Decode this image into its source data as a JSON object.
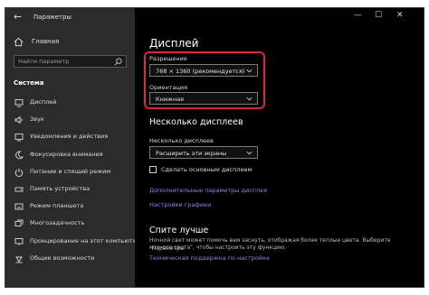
{
  "window": {
    "title": "Параметры",
    "controls": {
      "minimize": "—",
      "maximize": "☐",
      "close": "✕"
    }
  },
  "sidebar": {
    "home_label": "Главная",
    "search_placeholder": "Найти параметр",
    "section": "Система",
    "items": [
      {
        "label": "Дисплей",
        "icon": "monitor-icon"
      },
      {
        "label": "Звук",
        "icon": "speaker-icon"
      },
      {
        "label": "Уведомления и действия",
        "icon": "notification-icon"
      },
      {
        "label": "Фокусировка внимания",
        "icon": "moon-icon"
      },
      {
        "label": "Питание и спящий режим",
        "icon": "power-icon"
      },
      {
        "label": "Память устройства",
        "icon": "storage-icon"
      },
      {
        "label": "Режим планшета",
        "icon": "tablet-icon"
      },
      {
        "label": "Многозадачность",
        "icon": "multitask-icon"
      },
      {
        "label": "Проецирование на этот компьютер",
        "icon": "project-icon"
      },
      {
        "label": "Общие возможности",
        "icon": "share-icon"
      }
    ]
  },
  "main": {
    "title": "Дисплей",
    "resolution": {
      "label": "Разрешение",
      "value": "768 × 1360 (рекомендуется)"
    },
    "orientation": {
      "label": "Ориентация",
      "value": "Книжная"
    },
    "multi_heading": "Несколько дисплеев",
    "multi_label": "Несколько дисплеев",
    "multi_value": "Расширить эти экраны",
    "main_display_checkbox": "Сделать основным дисплеем",
    "advanced_link": "Дополнительные параметры дисплея",
    "graphics_link": "Настройки графики",
    "sleep_heading": "Спите лучше",
    "sleep_text_1": "Ночной свет может помочь вам заснуть, отображая более теплые цвета. Выберите \"Параметры",
    "sleep_text_2": "ночного света\", чтобы настроить эту функцию.",
    "support_link": "Техническая поддержка по настройке"
  },
  "colors": {
    "accent_link": "#a17de8",
    "highlight": "#e0243a"
  }
}
